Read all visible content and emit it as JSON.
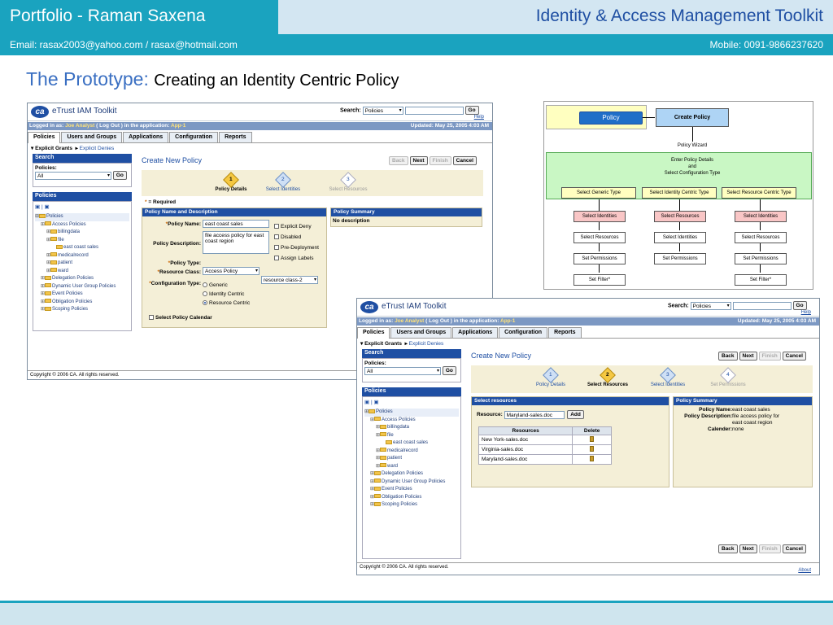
{
  "header": {
    "left_title": "Portfolio - Raman Saxena",
    "right_title": "Identity & Access Management Toolkit",
    "email": "Email: rasax2003@yahoo.com / rasax@hotmail.com",
    "mobile": "Mobile: 0091-9866237620"
  },
  "page_title": {
    "prefix": "The Prototype:",
    "rest": "Creating an Identity Centric Policy"
  },
  "app": {
    "title": "eTrust IAM Toolkit",
    "logo": "ca",
    "search_label": "Search:",
    "search_select": "Policies",
    "go": "Go",
    "help": "Help",
    "about": "About",
    "logged_prefix": "Logged in as:",
    "user": "Joe Analyst",
    "logout": "( Log Out )",
    "in_app": "in the application:",
    "app_name": "App-1",
    "updated": "Updated: May 25, 2005 4:03 AM",
    "tabs": [
      "Policies",
      "Users and Groups",
      "Applications",
      "Configuration",
      "Reports"
    ],
    "explicit_grants": "Explicit Grants",
    "explicit_denies": "Explicit Denies",
    "side_search": "Search",
    "side_policies_label": "Policies:",
    "side_all": "All",
    "side_policies_header": "Policies",
    "tree": [
      {
        "label": "Policies",
        "lvl": 0
      },
      {
        "label": "Access Policies",
        "lvl": 1
      },
      {
        "label": "billingdata",
        "lvl": 2
      },
      {
        "label": "file",
        "lvl": 2
      },
      {
        "label": "east coast sales",
        "lvl": 3
      },
      {
        "label": "medicalrecord",
        "lvl": 2
      },
      {
        "label": "patient",
        "lvl": 2
      },
      {
        "label": "ward",
        "lvl": 2
      },
      {
        "label": "Delegation Policies",
        "lvl": 1
      },
      {
        "label": "Dynamic User Group Policies",
        "lvl": 1
      },
      {
        "label": "Event Policies",
        "lvl": 1
      },
      {
        "label": "Obligation Policies",
        "lvl": 1
      },
      {
        "label": "Scoping Policies",
        "lvl": 1
      }
    ],
    "create_new_policy": "Create New Policy",
    "back": "Back",
    "next": "Next",
    "finish": "Finish",
    "cancel": "Cancel",
    "copyright": "Copyright © 2006 CA. All rights reserved."
  },
  "win1": {
    "steps": [
      {
        "n": "1",
        "label": "Policy Details"
      },
      {
        "n": "2",
        "label": "Select Identities"
      },
      {
        "n": "3",
        "label": "Select Resources"
      }
    ],
    "required": "= Required",
    "panel_title": "Policy Name and Description",
    "policy_name_label": "Policy Name:",
    "policy_name_value": "east coast sales",
    "policy_desc_label": "Policy Description:",
    "policy_desc_value": "file access policy for east coast region",
    "policy_type_label": "Policy Type:",
    "policy_type_value": "Access Policy",
    "resource_class_label": "Resource Class:",
    "resource_class_value": "resource class-2",
    "config_type_label": "Configuration Type:",
    "config_options": [
      "Generic",
      "Identity Centric",
      "Resource Centric"
    ],
    "checkboxes": [
      "Explicit Deny",
      "Disabled",
      "Pre-Deployment",
      "Assign Labels"
    ],
    "select_calendar": "Select Policy Calendar",
    "summary_title": "Policy Summary",
    "summary_value": "No description"
  },
  "win2": {
    "steps": [
      {
        "n": "1",
        "label": "Policy Details"
      },
      {
        "n": "2",
        "label": "Select Resources"
      },
      {
        "n": "3",
        "label": "Select Identities"
      },
      {
        "n": "4",
        "label": "Set Permissions"
      }
    ],
    "select_resources_title": "Select resources",
    "resource_label": "Resource:",
    "resource_value": "Maryland-sales.doc",
    "add": "Add",
    "table_headers": [
      "Resources",
      "Delete"
    ],
    "table_rows": [
      "New York-sales.doc",
      "Virginia-sales.doc",
      "Maryland-sales.doc"
    ],
    "summary_title": "Policy Summary",
    "summary_lines": [
      {
        "k": "Policy Name:",
        "v": "east coast sales"
      },
      {
        "k": "Policy Description:",
        "v": "file access policy for"
      },
      {
        "k": "",
        "v": "east coast region"
      },
      {
        "k": "Calender:",
        "v": "none"
      }
    ]
  },
  "flow": {
    "policy": "Policy",
    "create_policy": "Create Policy",
    "policy_wizard": "Policy Wizard",
    "enter_details": [
      "Enter Policy Details",
      "and",
      "Select Configuration Type"
    ],
    "types": [
      "Select Generic Type",
      "Select Identity Centric Type",
      "Select Resource Centric Type"
    ],
    "col1": [
      "Select Identities",
      "Select Resources",
      "Set Permissions",
      "Set Filter*"
    ],
    "col2": [
      "Select Resources",
      "Select Identities",
      "Set Permissions"
    ],
    "col3": [
      "Select Identities",
      "Select Resources",
      "Set Permissions",
      "Set Filter*"
    ],
    "colors": {
      "green": "#c9f7c4",
      "pink": "#f9c6c6",
      "blue": "#aed4f5",
      "yellow": "#ffffc0"
    }
  }
}
